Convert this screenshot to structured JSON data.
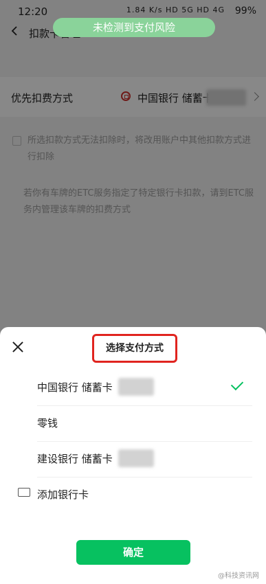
{
  "status_bar": {
    "time": "12:20",
    "icons": "1.84 K/s  HD 5G  HD 4G",
    "battery": "99%"
  },
  "nav": {
    "title": "扣款卡管理"
  },
  "toast": "未检测到支付风险",
  "payment_row": {
    "label": "优先扣费方式",
    "value": "中国银行 储蓄卡"
  },
  "notes": {
    "first": "所选扣款方式无法扣除时，将改用账户中其他扣款方式进行扣除",
    "second": "若你有车牌的ETC服务指定了特定银行卡扣款，请到ETC服务内管理该车牌的扣费方式"
  },
  "sheet": {
    "title": "选择支付方式",
    "options": [
      {
        "label": "中国银行 储蓄卡",
        "selected": true
      },
      {
        "label": "零钱",
        "selected": false
      },
      {
        "label": "建设银行 储蓄卡",
        "selected": false
      }
    ],
    "add_card": "添加银行卡",
    "confirm": "确定"
  },
  "watermark": "@科技资讯网",
  "colors": {
    "accent": "#07c160",
    "highlight": "#e0241f",
    "toast": "#8ad39a"
  }
}
